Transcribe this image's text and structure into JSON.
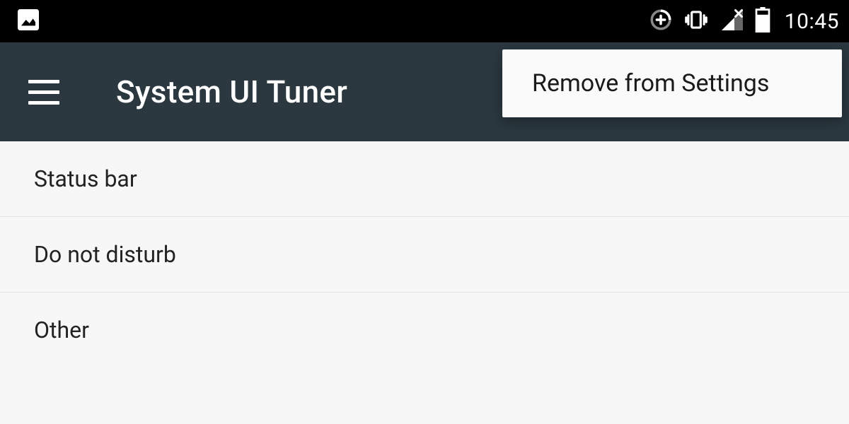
{
  "status_bar": {
    "time": "10:45"
  },
  "app_bar": {
    "title": "System UI Tuner"
  },
  "overflow_menu": {
    "items": [
      {
        "label": "Remove from Settings"
      }
    ]
  },
  "settings_list": {
    "items": [
      {
        "label": "Status bar"
      },
      {
        "label": "Do not disturb"
      },
      {
        "label": "Other"
      }
    ]
  }
}
